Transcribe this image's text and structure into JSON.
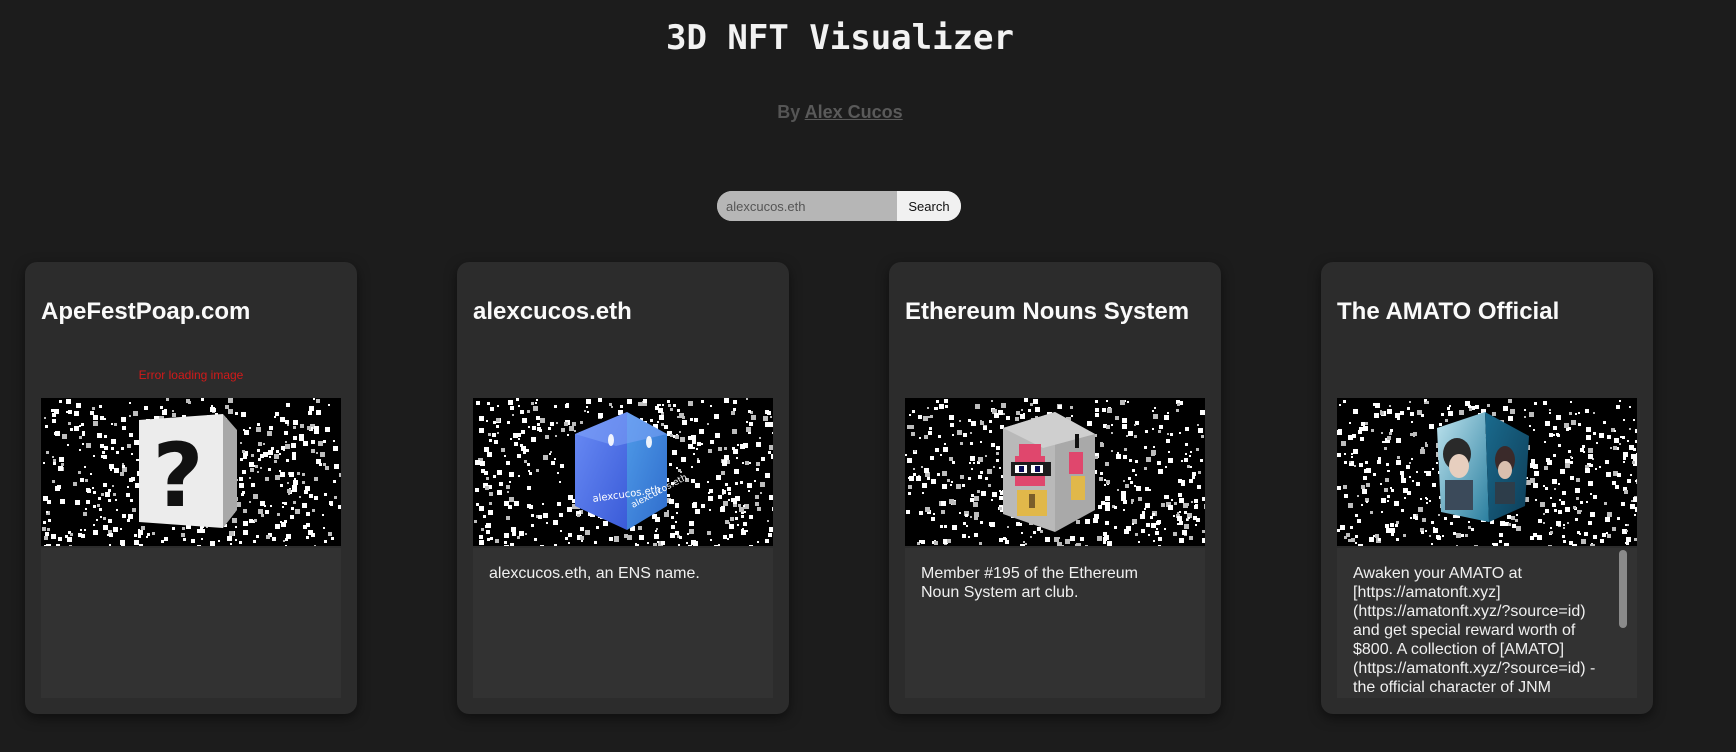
{
  "header": {
    "title": "3D NFT Visualizer",
    "byline_prefix": "By ",
    "author": "Alex Cucos"
  },
  "search": {
    "value": "alexcucos.eth",
    "placeholder": "alexcucos.eth",
    "button_label": "Search"
  },
  "cards": [
    {
      "title": "ApeFestPoap.com",
      "error": "Error loading image",
      "description": "",
      "cube": "question-mark-cube"
    },
    {
      "title": "alexcucos.eth",
      "error": "",
      "description": "alexcucos.eth, an ENS name.",
      "cube": "ens-cube"
    },
    {
      "title": "Ethereum Nouns System",
      "error": "",
      "description": "Member #195 of the Ethereum Noun System art club.",
      "cube": "noun-cube"
    },
    {
      "title": "The AMATO Official",
      "error": "",
      "description": "Awaken your AMATO at [https://amatonft.xyz](https://amatonft.xyz/?source=id) and get special reward worth of $800. A collection of [AMATO](https://amatonft.xyz/?source=id) - the official character of JNM Studio.",
      "cube": "amato-cube"
    }
  ],
  "colors": {
    "background": "#1c1c1c",
    "card": "#2c2c2c",
    "description_box": "#323232",
    "error": "#d21a1a"
  }
}
